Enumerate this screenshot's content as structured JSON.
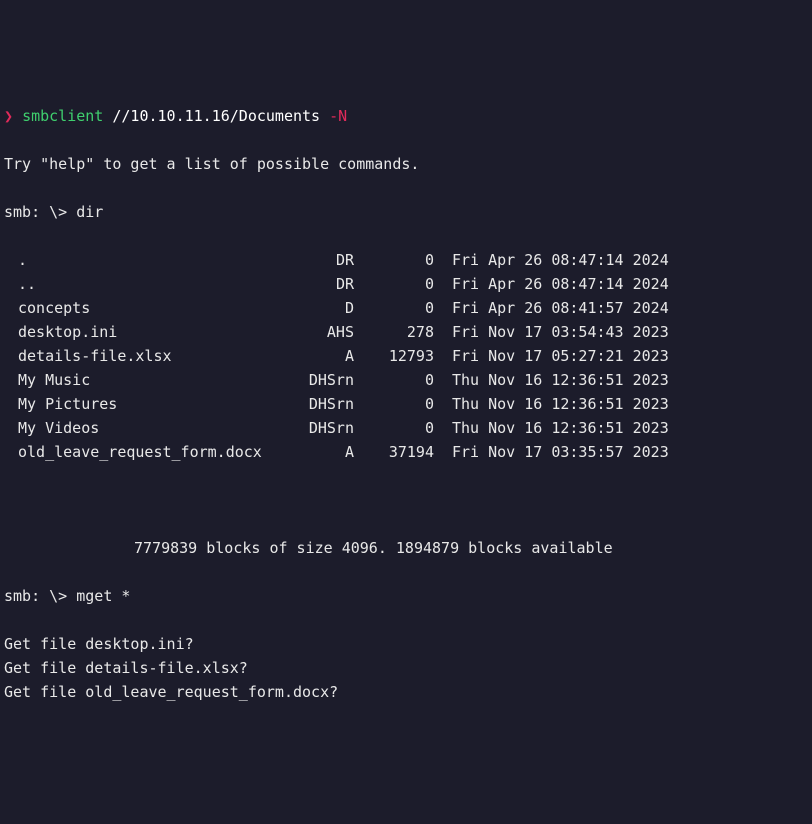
{
  "prompt": {
    "symbol": "❯",
    "command": "smbclient",
    "target": "//10.10.11.16/Documents",
    "flag": "-N"
  },
  "help_line": "Try \"help\" to get a list of possible commands.",
  "smb_prompt": "smb: \\>",
  "dir_cmd": "dir",
  "listing": [
    {
      "name": ".",
      "attr": "DR",
      "size": "0",
      "date": "Fri Apr 26 08:47:14 2024"
    },
    {
      "name": "..",
      "attr": "DR",
      "size": "0",
      "date": "Fri Apr 26 08:47:14 2024"
    },
    {
      "name": "concepts",
      "attr": "D",
      "size": "0",
      "date": "Fri Apr 26 08:41:57 2024"
    },
    {
      "name": "desktop.ini",
      "attr": "AHS",
      "size": "278",
      "date": "Fri Nov 17 03:54:43 2023"
    },
    {
      "name": "details-file.xlsx",
      "attr": "A",
      "size": "12793",
      "date": "Fri Nov 17 05:27:21 2023"
    },
    {
      "name": "My Music",
      "attr": "DHSrn",
      "size": "0",
      "date": "Thu Nov 16 12:36:51 2023"
    },
    {
      "name": "My Pictures",
      "attr": "DHSrn",
      "size": "0",
      "date": "Thu Nov 16 12:36:51 2023"
    },
    {
      "name": "My Videos",
      "attr": "DHSrn",
      "size": "0",
      "date": "Thu Nov 16 12:36:51 2023"
    },
    {
      "name": "old_leave_request_form.docx",
      "attr": "A",
      "size": "37194",
      "date": "Fri Nov 17 03:35:57 2023"
    }
  ],
  "blocks_line": "7779839 blocks of size 4096. 1894879 blocks available",
  "mget_cmd": "mget *",
  "get_prompts": [
    "Get file desktop.ini?",
    "Get file details-file.xlsx?",
    "Get file old_leave_request_form.docx?"
  ]
}
